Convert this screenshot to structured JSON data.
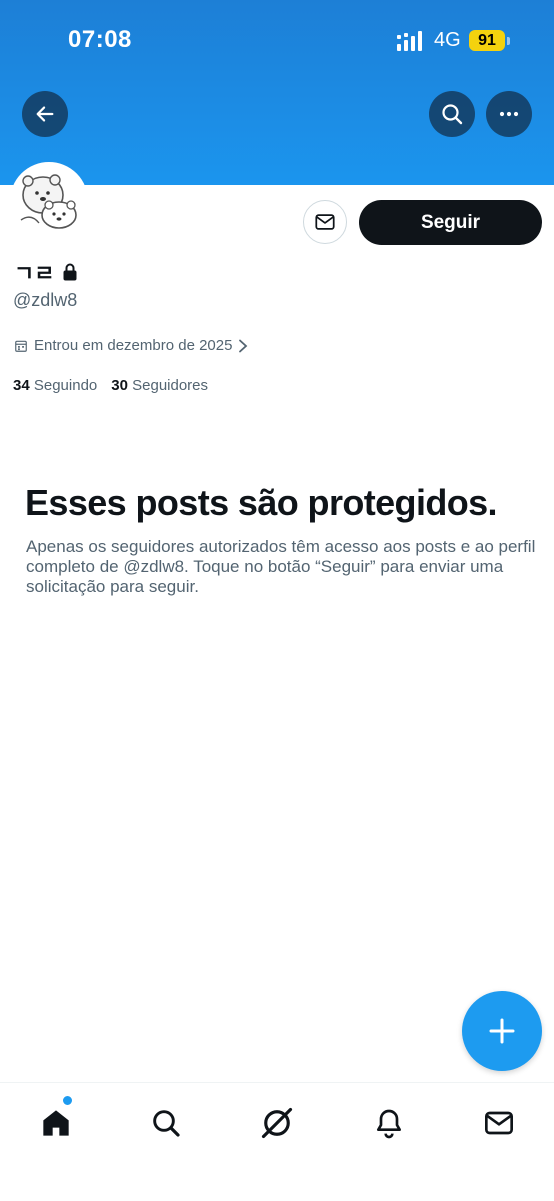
{
  "status_bar": {
    "time": "07:08",
    "network": "4G",
    "battery": "91"
  },
  "header": {
    "back_icon": "back-arrow-icon",
    "search_icon": "search-icon",
    "more_icon": "more-icon"
  },
  "profile": {
    "display_name": "ㄱㄹ",
    "handle": "@zdlw8",
    "joined": "Entrou em dezembro de 2025",
    "following_count": "34",
    "following_label": "Seguindo",
    "followers_count": "30",
    "followers_label": "Seguidores",
    "follow_label": "Seguir"
  },
  "protected_notice": {
    "title": "Esses posts são protegidos.",
    "body": "Apenas os seguidores autorizados têm acesso aos posts e ao perfil completo de @zdlw8. Toque no botão “Seguir” para enviar uma solicitação para seguir."
  },
  "bottom_nav": {
    "items": [
      "home-icon",
      "search-icon",
      "grok-icon",
      "notifications-icon",
      "messages-icon"
    ]
  },
  "colors": {
    "accent": "#1d9bf0",
    "banner": "#1b8ee8",
    "text_primary": "#0f1419",
    "text_secondary": "#536471",
    "battery": "#f4d20e"
  }
}
